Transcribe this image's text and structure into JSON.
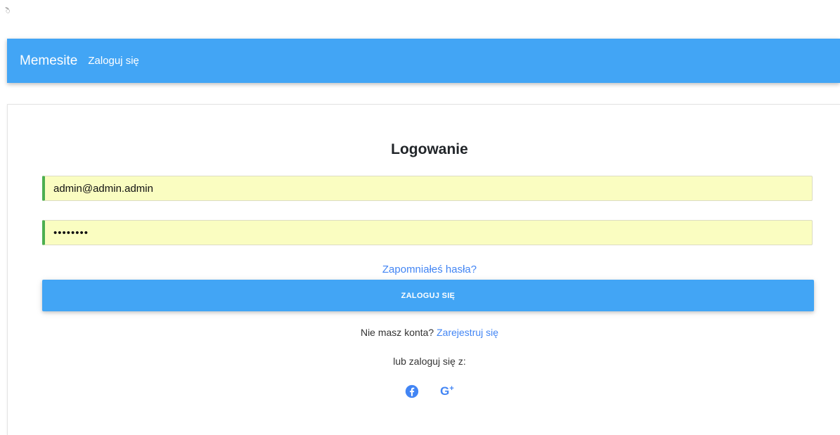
{
  "corner_mark": "ॆ",
  "navbar": {
    "brand": "Memesite",
    "login_link": "Zaloguj się"
  },
  "login_form": {
    "title": "Logowanie",
    "email_value": "admin@admin.admin",
    "password_value": "••••••••",
    "forgot_password": "Zapomniałeś hasła?",
    "login_button": "ZALOGUJ SIĘ",
    "no_account_text": "Nie masz konta?",
    "register_link": "Zarejestruj się",
    "social_label": "lub zaloguj się z:"
  },
  "social": {
    "google_text": "G",
    "google_plus": "+",
    "facebook_icon": "facebook-icon",
    "google_icon": "google-plus-icon"
  },
  "colors": {
    "primary": "#42a5f5",
    "link": "#4285f4",
    "valid_border": "#4caf50",
    "autofill_bg": "#fafdc1"
  }
}
